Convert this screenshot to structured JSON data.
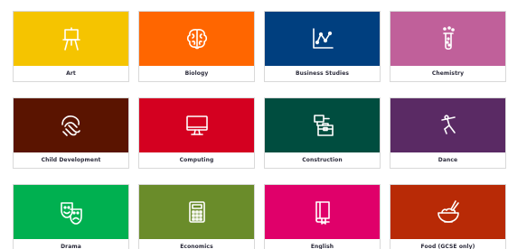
{
  "subjects": [
    {
      "label": "Art",
      "icon": "easel-icon",
      "color": "#f5c400"
    },
    {
      "label": "Biology",
      "icon": "brain-icon",
      "color": "#ff6600"
    },
    {
      "label": "Business Studies",
      "icon": "line-chart-icon",
      "color": "#003f7f"
    },
    {
      "label": "Chemistry",
      "icon": "test-tube-icon",
      "color": "#c0609a"
    },
    {
      "label": "Child Development",
      "icon": "hands-icon",
      "color": "#5a1400"
    },
    {
      "label": "Computing",
      "icon": "monitor-icon",
      "color": "#d40020"
    },
    {
      "label": "Construction",
      "icon": "drill-toolbox-icon",
      "color": "#004d3f"
    },
    {
      "label": "Dance",
      "icon": "dancer-icon",
      "color": "#5a2a64"
    },
    {
      "label": "Drama",
      "icon": "theatre-masks-icon",
      "color": "#00b050"
    },
    {
      "label": "Economics",
      "icon": "calculator-icon",
      "color": "#6a8c2a"
    },
    {
      "label": "English",
      "icon": "book-icon",
      "color": "#e0006a"
    },
    {
      "label": "Food (GCSE only)",
      "icon": "food-bowl-icon",
      "color": "#b82a06"
    }
  ]
}
